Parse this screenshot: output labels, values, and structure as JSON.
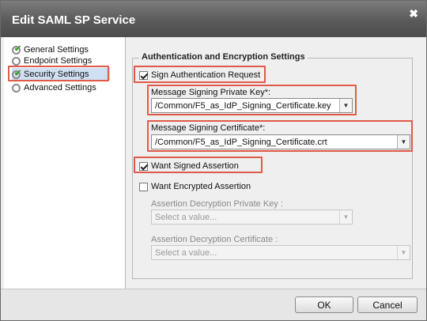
{
  "dialog": {
    "title": "Edit SAML SP Service"
  },
  "sidebar": {
    "items": [
      {
        "label": "General Settings"
      },
      {
        "label": "Endpoint Settings"
      },
      {
        "label": "Security Settings"
      },
      {
        "label": "Advanced Settings"
      }
    ]
  },
  "section": {
    "legend": "Authentication and Encryption Settings"
  },
  "fields": {
    "sign_auth_request": {
      "label": "Sign Authentication Request",
      "checked": true
    },
    "signing_key": {
      "label": "Message Signing Private Key*:",
      "value": "/Common/F5_as_IdP_Signing_Certificate.key"
    },
    "signing_cert": {
      "label": "Message Signing Certificate*:",
      "value": "/Common/F5_as_IdP_Signing_Certificate.crt"
    },
    "want_signed_assertion": {
      "label": "Want Signed Assertion",
      "checked": true
    },
    "want_encrypted_assertion": {
      "label": "Want Encrypted Assertion",
      "checked": false
    },
    "decryption_key": {
      "label": "Assertion Decryption Private Key :",
      "placeholder": "Select a value..."
    },
    "decryption_cert": {
      "label": "Assertion Decryption Certificate :",
      "placeholder": "Select a value..."
    }
  },
  "footer": {
    "ok_label": "OK",
    "cancel_label": "Cancel"
  },
  "colors": {
    "highlight": "#e05a4a",
    "selected_nav": "#cfe0f3",
    "titlebar": "#5a5a5a"
  }
}
